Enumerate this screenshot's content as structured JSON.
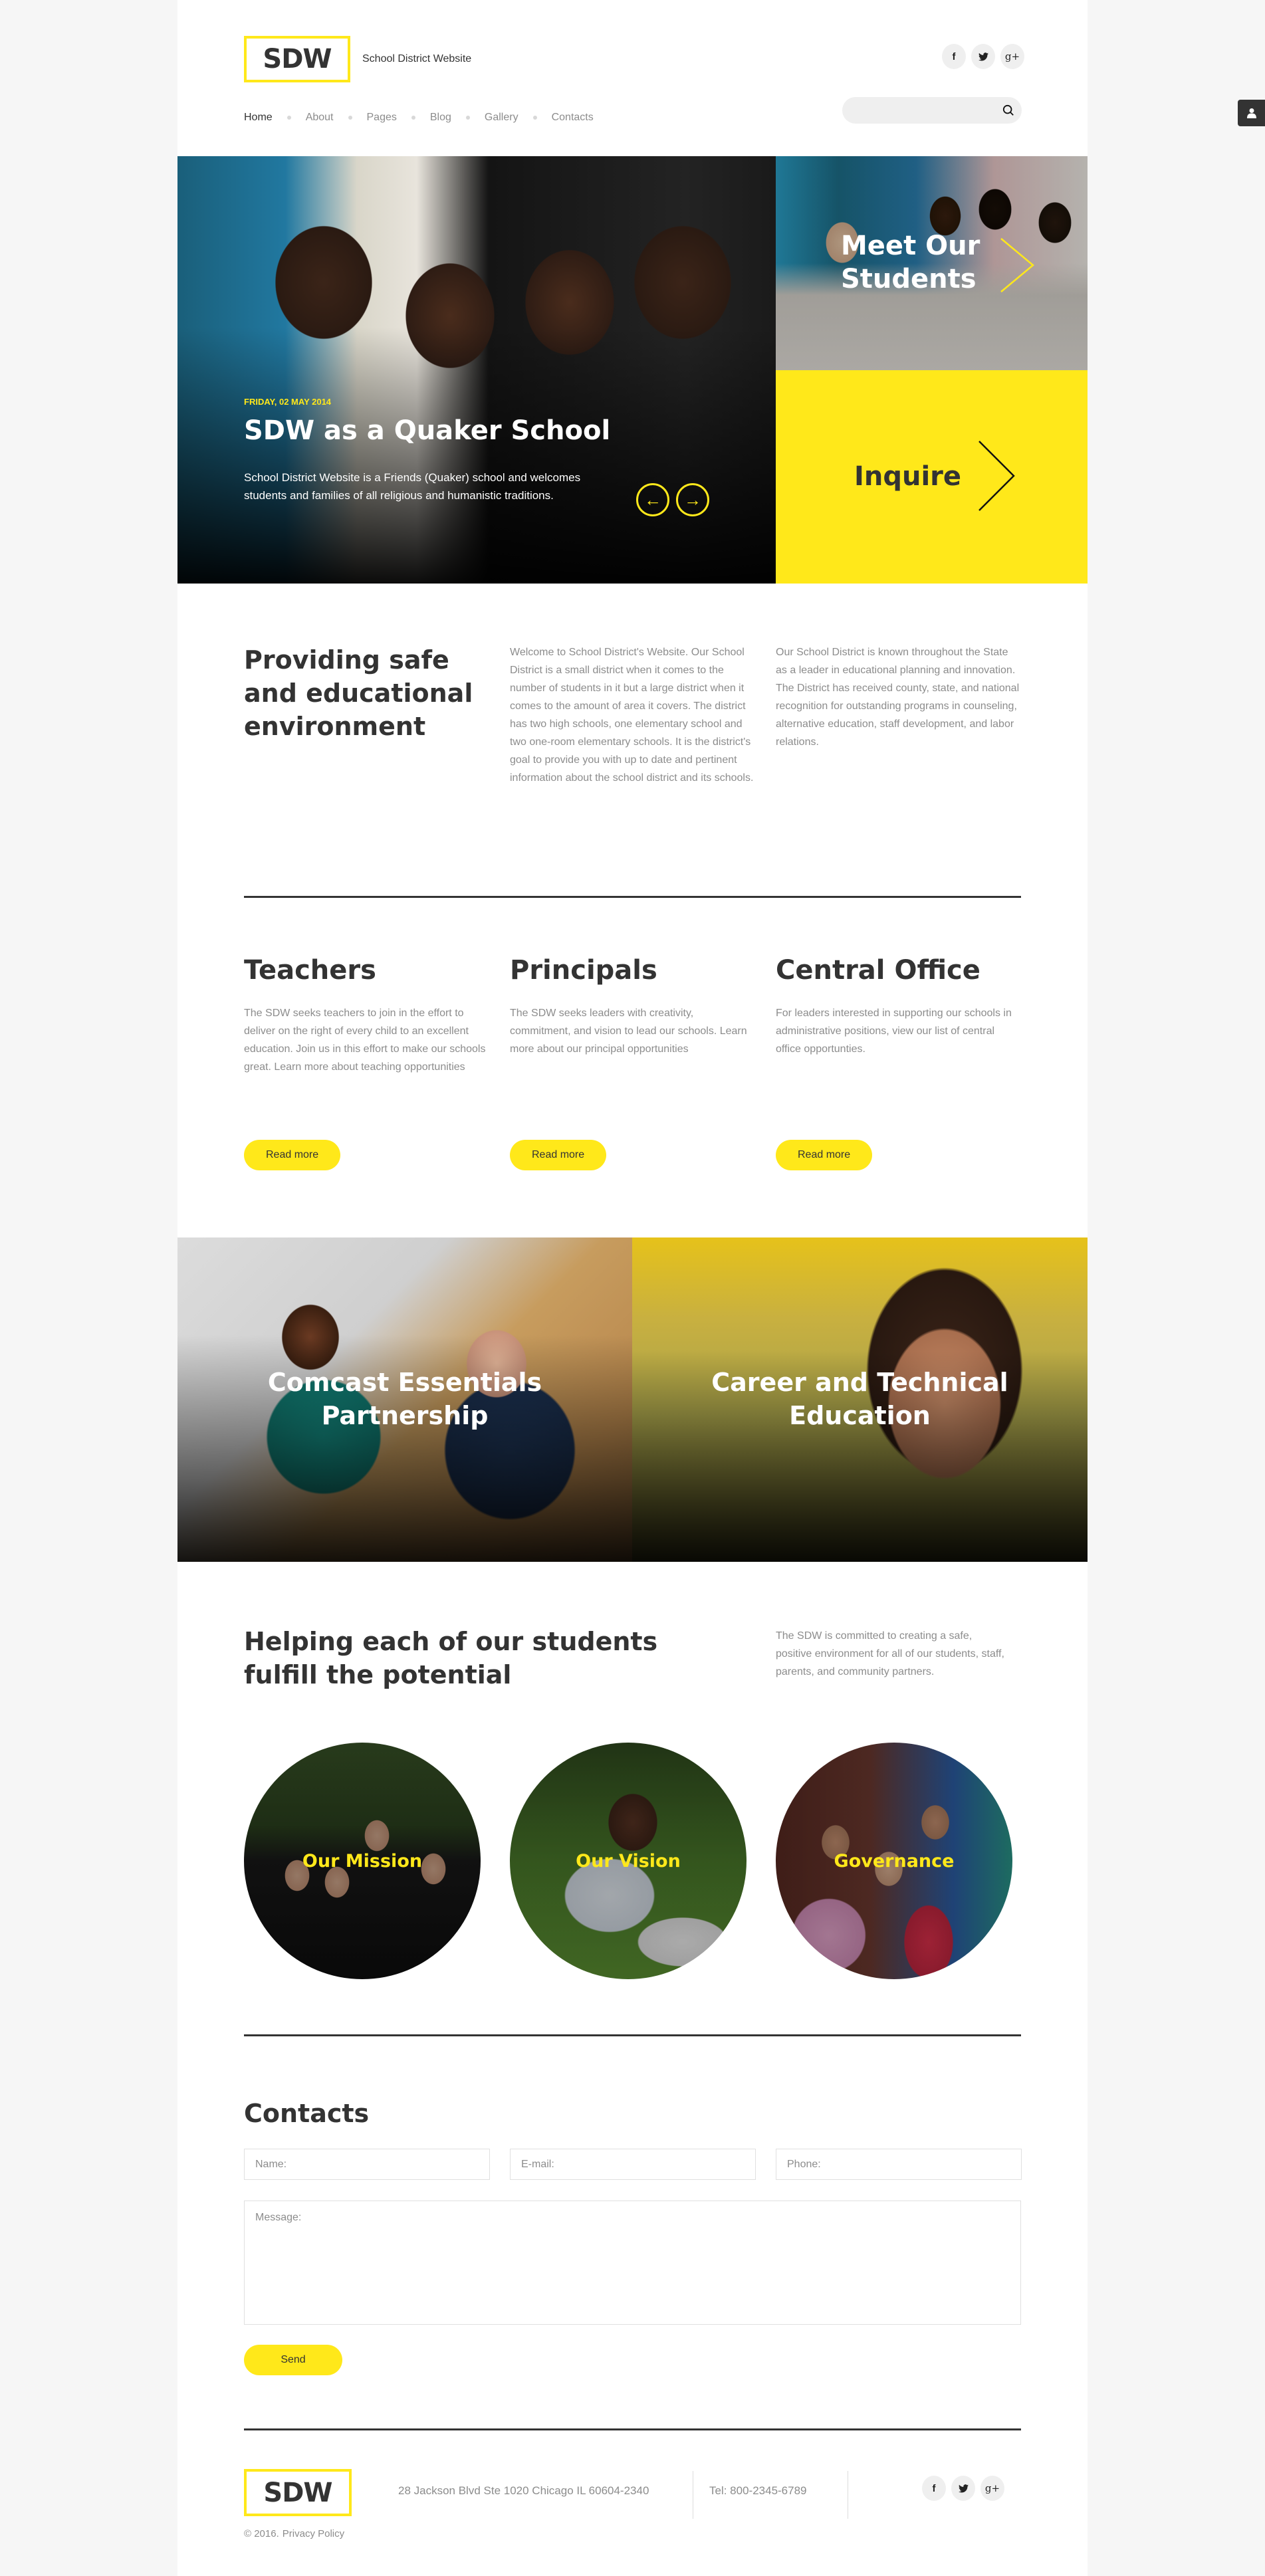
{
  "colors": {
    "accent": "#ffe81a",
    "text_dark": "#333333",
    "text_muted": "#8c8c8c",
    "page_bg": "#f6f6f6"
  },
  "header": {
    "logo": "SDW",
    "tagline": "School District Website",
    "nav": [
      {
        "label": "Home",
        "active": true
      },
      {
        "label": "About"
      },
      {
        "label": "Pages"
      },
      {
        "label": "Blog"
      },
      {
        "label": "Gallery"
      },
      {
        "label": "Contacts"
      }
    ],
    "social": [
      {
        "icon": "facebook-icon",
        "glyph": "f"
      },
      {
        "icon": "twitter-icon",
        "glyph": "🐦"
      },
      {
        "icon": "google-plus-icon",
        "glyph": "g+"
      }
    ],
    "search": {
      "placeholder": "",
      "value": ""
    }
  },
  "side_tab": {
    "icon": "user-icon"
  },
  "hero": {
    "date": "FRIDAY, 02 MAY 2014",
    "title": "SDW as a Quaker School",
    "text": "School District Website is a Friends (Quaker) school and welcomes students and families of all religious and humanistic traditions.",
    "prev_glyph": "←",
    "next_glyph": "→",
    "side_top_label": "Meet Our Students",
    "side_bottom_label": "Inquire"
  },
  "about": {
    "title": "Providing safe and educational environment",
    "col2": "Welcome to School District's Website. Our School District is a small district when it comes to the number of students in it but a large district when it comes to the amount of area it covers. The district has two high schools, one elementary school and two one-room elementary schools. It is the district's goal to provide you with up to date and pertinent information about the school district and its schools.",
    "col3": "Our School District is known throughout the State as a leader in educational planning and innovation. The District has received county, state, and national recognition for outstanding programs in counseling, alternative education, staff development, and labor relations."
  },
  "cards": [
    {
      "title": "Teachers",
      "text": "The SDW seeks teachers to join in the effort to deliver on the right of every child to an excellent education. Join us in this effort to make our schools great. Learn more about teaching opportunities",
      "button": "Read more"
    },
    {
      "title": "Principals",
      "text": "The SDW seeks leaders with creativity, commitment, and vision to lead our schools. Learn more about our principal opportunities",
      "button": "Read more"
    },
    {
      "title": "Central Office",
      "text": "For leaders interested in supporting our schools in administrative positions, view our list of central office opportunties.",
      "button": "Read more"
    }
  ],
  "banners": [
    {
      "label": "Comcast Essentials Partnership"
    },
    {
      "label": "Career and Technical Education"
    }
  ],
  "helping": {
    "title": "Helping each of our students fulfill the potential",
    "text": "The SDW is committed to creating a safe, positive environment for all of our students, staff, parents, and community partners.",
    "circles": [
      {
        "label": "Our Mission"
      },
      {
        "label": "Our Vision"
      },
      {
        "label": "Governance"
      }
    ]
  },
  "contacts": {
    "title": "Contacts",
    "name_placeholder": "Name:",
    "email_placeholder": "E-mail:",
    "phone_placeholder": "Phone:",
    "message_placeholder": "Message:",
    "send": "Send"
  },
  "footer": {
    "logo": "SDW",
    "address": "28 Jackson Blvd Ste 1020 Chicago IL 60604-2340",
    "tel": "Tel: 800-2345-6789",
    "copyright": "© 2016.",
    "privacy": "Privacy Policy"
  }
}
